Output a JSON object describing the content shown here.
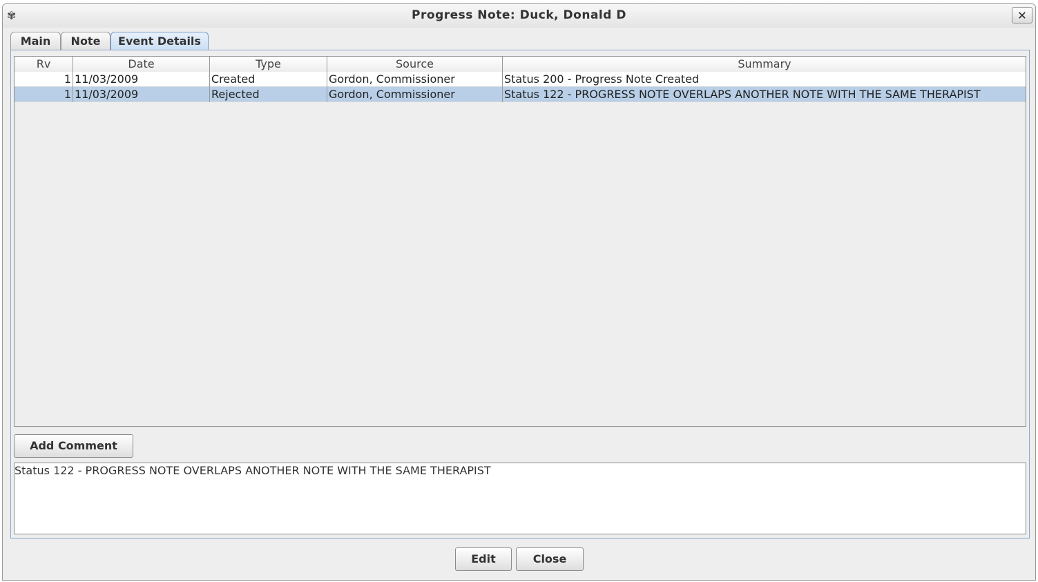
{
  "window": {
    "title": "Progress Note: Duck, Donald D",
    "close_label": "✕"
  },
  "tabs": [
    {
      "label": "Main",
      "active": false
    },
    {
      "label": "Note",
      "active": false
    },
    {
      "label": "Event Details",
      "active": true
    }
  ],
  "table": {
    "columns": [
      "Rv",
      "Date",
      "Type",
      "Source",
      "Summary"
    ],
    "rows": [
      {
        "rv": "1",
        "date": "11/03/2009",
        "type": "Created",
        "source": "Gordon, Commissioner",
        "summary": "Status 200 - Progress Note Created",
        "selected": false
      },
      {
        "rv": "1",
        "date": "11/03/2009",
        "type": "Rejected",
        "source": "Gordon, Commissioner",
        "summary": "Status 122 - PROGRESS NOTE OVERLAPS ANOTHER NOTE WITH THE SAME THERAPIST",
        "selected": true
      }
    ]
  },
  "add_comment": {
    "label": "Add Comment",
    "mnemonic": "C"
  },
  "comment_text": "Status 122 - PROGRESS NOTE OVERLAPS ANOTHER NOTE WITH THE SAME THERAPIST",
  "footer": {
    "edit_label": "Edit",
    "close_label": "Close"
  },
  "icons": {
    "app": "app-icon",
    "close": "close-icon"
  },
  "colors": {
    "selected_row": "#b8cfe7",
    "active_tab": "#c9ddf3"
  }
}
